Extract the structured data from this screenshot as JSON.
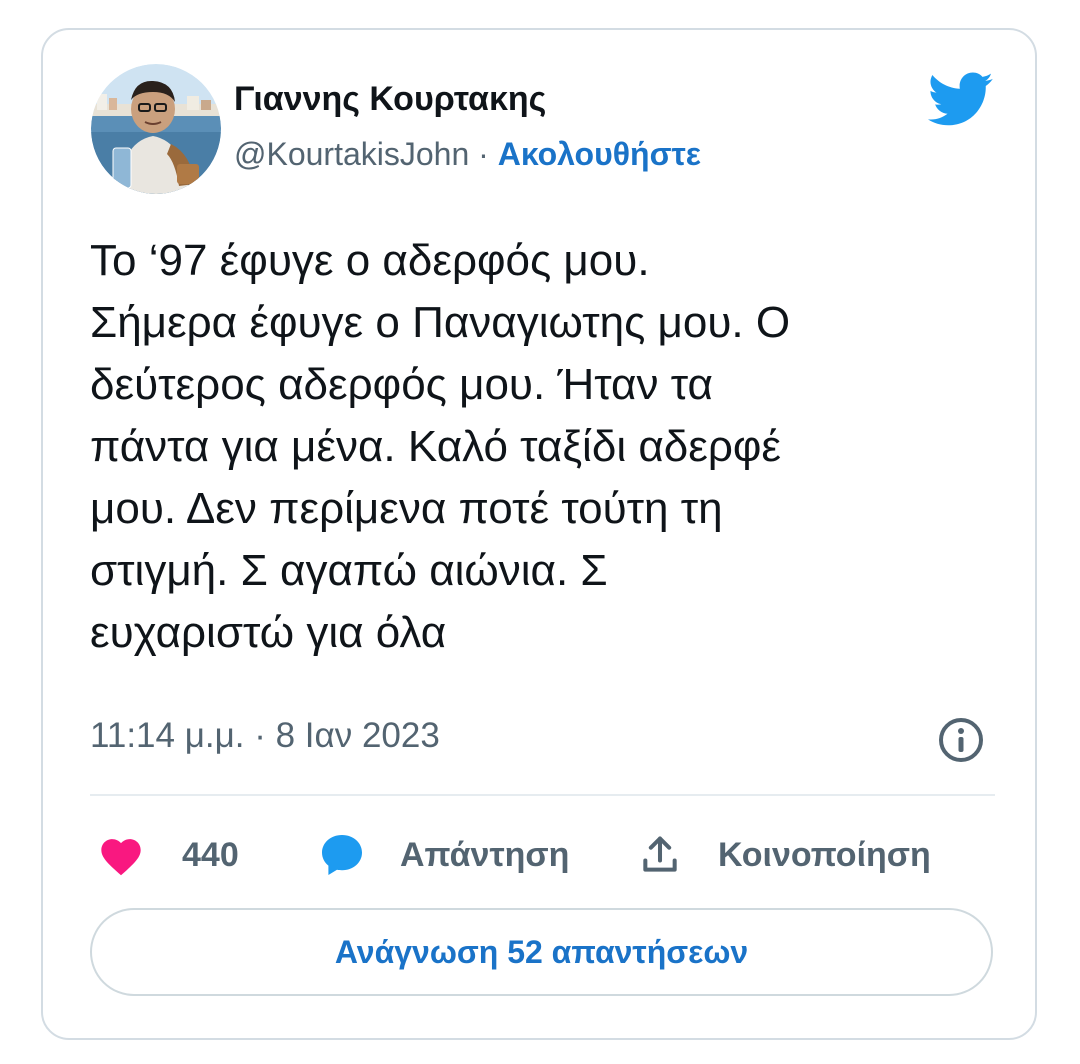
{
  "author": {
    "display_name": "Γιαννης Κουρτακης",
    "handle": "@KourtakisJohn",
    "separator": " · ",
    "follow_label": "Ακολουθήστε"
  },
  "tweet": {
    "lines": [
      "Το ‘97 έφυγε ο αδερφός μου.",
      "Σήμερα έφυγε ο Παναγιωτης μου. Ο",
      "δεύτερος αδερφός μου. Ήταν τα",
      "πάντα για μένα. Καλό ταξίδι αδερφέ",
      "μου. Δεν περίμενα ποτέ τούτη τη",
      "στιγμή. Σ αγαπώ αιώνια. Σ",
      "ευχαριστώ για όλα"
    ],
    "timestamp": "11:14 μ.μ. · 8 Ιαν 2023"
  },
  "actions": {
    "like_count": "440",
    "reply_label": "Απάντηση",
    "share_label": "Κοινοποίηση"
  },
  "read_replies_label": "Ανάγνωση 52 απαντήσεων",
  "icons": {
    "brand": "twitter-bird-icon",
    "info": "info-icon",
    "like": "heart-icon",
    "reply": "speech-bubble-icon",
    "share": "share-upload-icon"
  },
  "colors": {
    "twitter_blue": "#1d9bf0",
    "link_blue": "#1a73c8",
    "heart_pink": "#f91880",
    "text_primary": "#0f1419",
    "text_secondary": "#536471",
    "border": "#cfd9de"
  }
}
